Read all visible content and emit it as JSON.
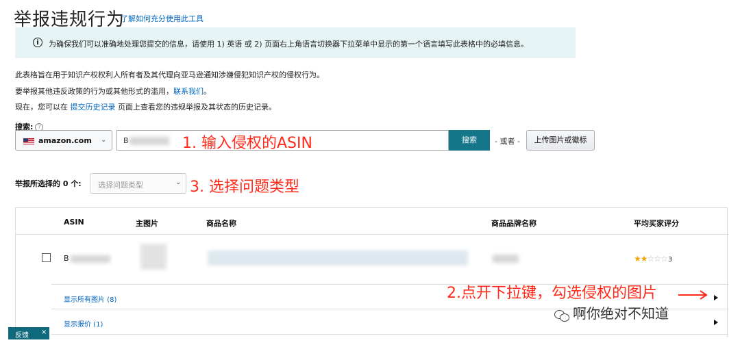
{
  "header": {
    "title": "举报违规行为",
    "help_link": "了解如何充分使用此工具"
  },
  "info_box": {
    "icon": "info-icon",
    "text": "为确保我们可以准确地处理您提交的信息，请使用 1) 英语 或 2) 页面右上角语言切换器下拉菜单中显示的第一个语言填写此表格中的必填信息。"
  },
  "intro": {
    "line1": "此表格旨在用于知识产权权利人所有者及其代理向亚马逊通知涉嫌侵犯知识产权的侵权行为。",
    "line2_before": "要举报其他违反政策的行为或其他形式的滥用，",
    "line2_link": "联系我们",
    "line2_after": "。",
    "line3_before": "现在，您可以在 ",
    "line3_link": "提交历史记录",
    "line3_after": " 页面上查看您的违规举报及其状态的历史记录。"
  },
  "search": {
    "label": "搜索:",
    "help_icon": "?",
    "marketplace": "amazon.com",
    "flag_icon": "us-flag-icon",
    "input_value": "B",
    "button": "搜索",
    "or_text": "- 或者 -",
    "upload_button": "上传图片或徽标"
  },
  "issue": {
    "label": "举报所选择的 0 个:",
    "placeholder": "选择问题类型"
  },
  "table": {
    "headers": [
      "ASIN",
      "主图片",
      "商品名称",
      "商品品牌名称",
      "平均买家评分"
    ],
    "row": {
      "asin": "B",
      "rating_value": 3,
      "stars_filled": 2,
      "stars_total": 5,
      "rating_text": "3"
    },
    "show_images": "显示所有图片 (8)",
    "show_offers": "显示报价 (1)"
  },
  "annotations": {
    "step1": "1. 输入侵权的ASIN",
    "step2": "2.点开下拉键，勾选侵权的图片",
    "step3": "3. 选择问题类型",
    "color": "#ff2a1a"
  },
  "feedback": {
    "label": "反馈",
    "close": "×"
  },
  "watermark": {
    "text": "啊你绝对不知道"
  },
  "colors": {
    "search_button": "#147688",
    "info_box": "#e7f4f5",
    "link": "#0066c0",
    "star": "#f1a307"
  }
}
